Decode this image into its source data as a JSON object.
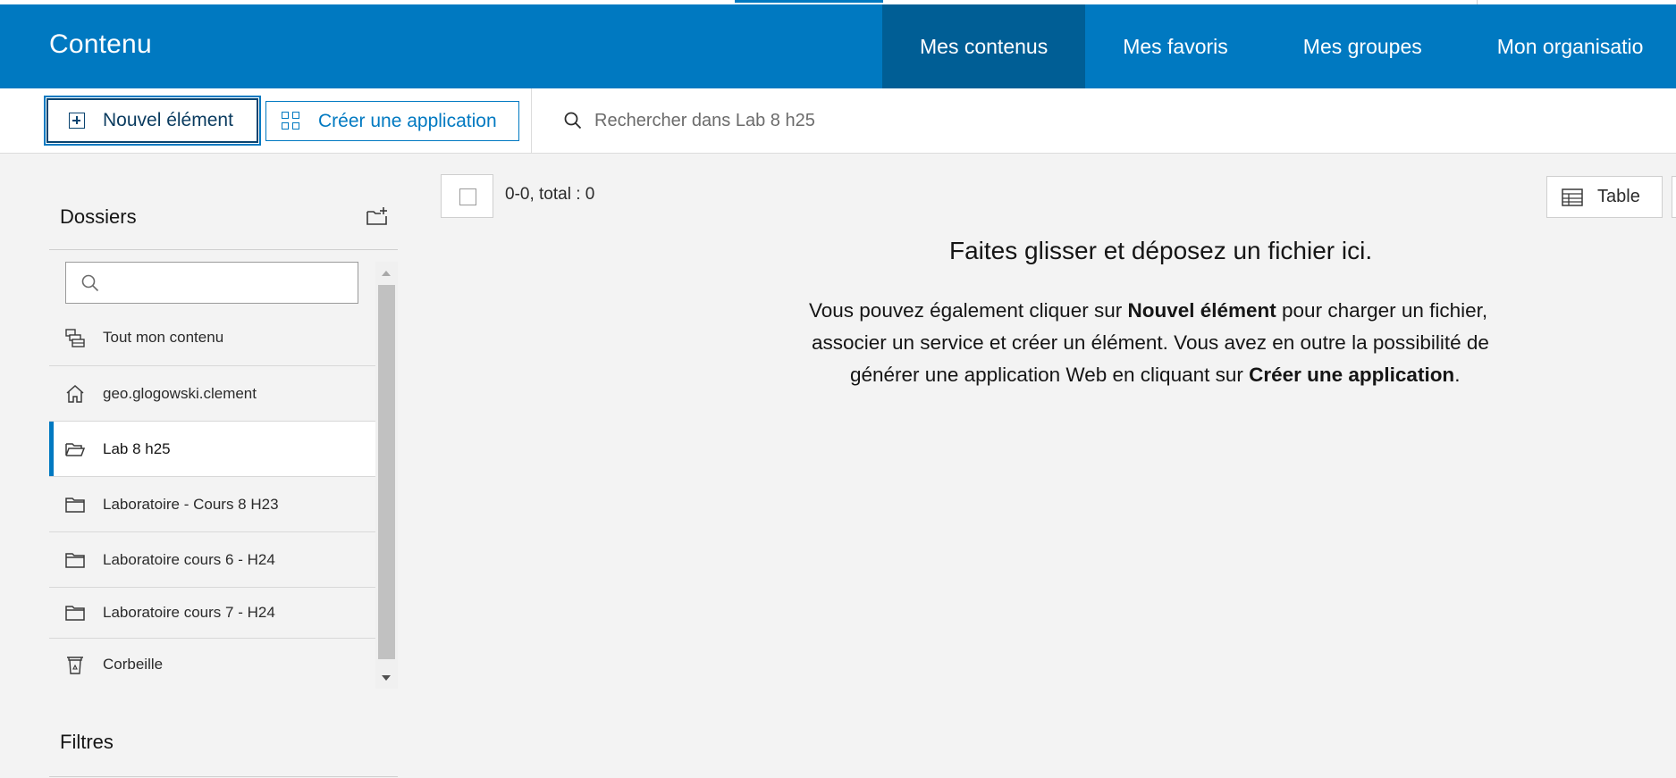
{
  "header": {
    "title": "Contenu",
    "tabs": [
      {
        "label": "Mes contenus",
        "active": true
      },
      {
        "label": "Mes favoris",
        "active": false
      },
      {
        "label": "Mes groupes",
        "active": false
      },
      {
        "label": "Mon organisatio",
        "active": false
      }
    ]
  },
  "toolbar": {
    "new_item_label": "Nouvel élément",
    "new_item_icon": "plus-square-icon",
    "create_app_label": "Créer une application",
    "create_app_icon": "grid-icon",
    "search_placeholder": "Rechercher dans Lab 8 h25",
    "search_icon": "search-icon"
  },
  "sidebar": {
    "folders_heading": "Dossiers",
    "new_folder_icon": "folder-plus-icon",
    "filter_icon": "search-icon",
    "items": [
      {
        "label": "Tout mon contenu",
        "icon": "all-content-icon",
        "active": false
      },
      {
        "label": "geo.glogowski.clement",
        "icon": "home-icon",
        "active": false
      },
      {
        "label": "Lab 8 h25",
        "icon": "folder-open-icon",
        "active": true
      },
      {
        "label": "Laboratoire - Cours 8 H23",
        "icon": "folder-icon",
        "active": false
      },
      {
        "label": "Laboratoire cours 6 - H24",
        "icon": "folder-icon",
        "active": false
      },
      {
        "label": "Laboratoire cours 7 - H24",
        "icon": "folder-icon",
        "active": false
      }
    ],
    "trash": {
      "label": "Corbeille",
      "icon": "recycle-bin-icon"
    },
    "filters_heading": "Filtres"
  },
  "main": {
    "count_text": "0-0, total : 0",
    "view_label": "Table",
    "view_icon": "table-icon",
    "drop_title": "Faites glisser et déposez un fichier ici.",
    "drop_text": {
      "line1_a": "Vous pouvez également cliquer sur ",
      "line1_bold": "Nouvel élément",
      "line1_b": " pour charger un fichier,",
      "line2": "associer un service et créer un élément. Vous avez en outre la possibilité de",
      "line3_a": "générer une application Web en cliquant sur ",
      "line3_bold": "Créer une application",
      "line3_b": "."
    }
  },
  "colors": {
    "brand_blue": "#0079c1",
    "active_tab": "#005e95",
    "button_dark": "#0a4470"
  }
}
